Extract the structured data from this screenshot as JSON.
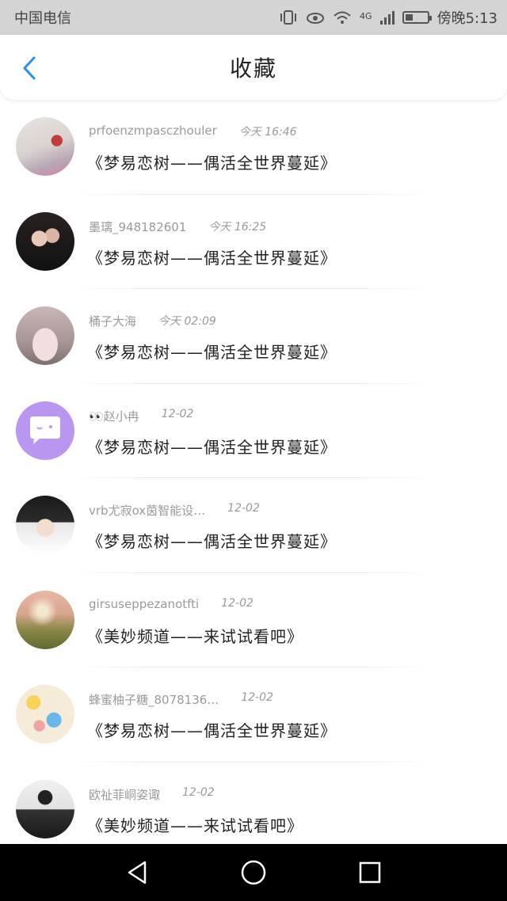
{
  "status_bar": {
    "carrier": "中国电信",
    "network": "4G",
    "time": "傍晚5:13",
    "battery_level": 0.45
  },
  "header": {
    "title": "收藏",
    "back_icon": "chevron-left-icon",
    "accent": "#2b8fe6"
  },
  "favorites": [
    {
      "user": "prfoenzmpasczhouler",
      "time": "今天 16:46",
      "content": "《梦易恋树——偶活全世界蔓延》"
    },
    {
      "user": "墨璃_948182601",
      "time": "今天 16:25",
      "content": "《梦易恋树——偶活全世界蔓延》"
    },
    {
      "user": "桶子大海",
      "time": "今天 02:09",
      "content": "《梦易恋树——偶活全世界蔓延》"
    },
    {
      "user": "👀赵小冉",
      "time": "12-02",
      "content": "《梦易恋树——偶活全世界蔓延》"
    },
    {
      "user": "vrb尤寂ox茵智能设…",
      "time": "12-02",
      "content": "《梦易恋树——偶活全世界蔓延》"
    },
    {
      "user": "girsuseppezanotfti",
      "time": "12-02",
      "content": "《美妙频道——来试试看吧》"
    },
    {
      "user": "蜂蜜柚子糖_8078136…",
      "time": "12-02",
      "content": "《梦易恋树——偶活全世界蔓延》"
    },
    {
      "user": "欧祉菲峒姿诹",
      "time": "12-02",
      "content": "《美妙频道——来试试看吧》"
    }
  ],
  "bottom_nav": {
    "back_icon": "triangle-back-icon",
    "home_icon": "circle-home-icon",
    "recents_icon": "square-recents-icon"
  }
}
